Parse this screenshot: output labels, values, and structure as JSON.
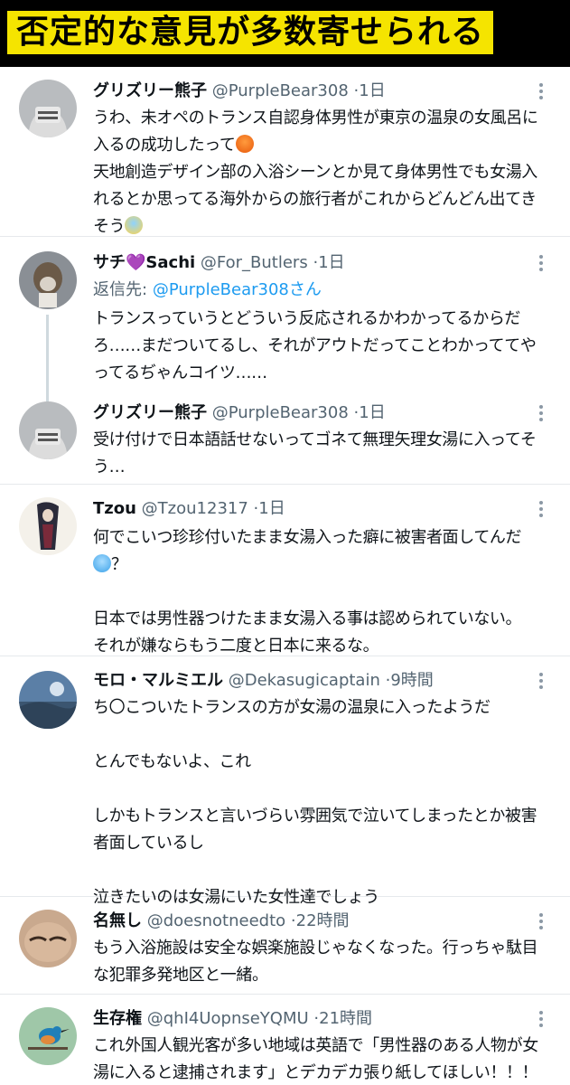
{
  "banner": {
    "title": "否定的な意見が多数寄せられる"
  },
  "tweets": [
    {
      "name": "グリズリー熊子",
      "handle": "@PurpleBear308",
      "sep": "·",
      "time": "1日",
      "lines": [
        "うわ、未オペのトランス自認身体男性が東京の温泉の女風呂に",
        "入るの成功したって",
        "天地創造デザイン部の入浴シーンとか見て身体男性でも女湯入",
        "れるとか思ってる海外からの旅行者がこれからどんどん出てき",
        "そう"
      ],
      "emoji": [
        "angry-face-icon",
        "screaming-face-icon"
      ]
    },
    {
      "name": "サチ",
      "name_suffix": "Sachi",
      "heart": "💜",
      "handle": "@For_Butlers",
      "sep": "·",
      "time": "1日",
      "reply_label": "返信先:",
      "reply_mention": "@PurpleBear308さん",
      "lines": [
        "トランスっていうとどういう反応されるかわかってるからだ",
        "ろ……まだついてるし、それがアウトだってことわかっててや",
        "ってるぢゃんコイツ……"
      ]
    },
    {
      "name": "グリズリー熊子",
      "handle": "@PurpleBear308",
      "sep": "·",
      "time": "1日",
      "lines": [
        "受け付けで日本語話せないってゴネて無理矢理女湯に入ってそ",
        "う…"
      ]
    },
    {
      "name": "Tzou",
      "handle": "@Tzou12317",
      "sep": "·",
      "time": "1日",
      "lines": [
        "何でこいつ珍珍付いたまま女湯入った癖に被害者面してんだ",
        "？",
        "",
        "日本では男性器つけたまま女湯入る事は認められていない。",
        "それが嫌ならもう二度と日本に来るな。"
      ],
      "emoji": [
        "cold-face-icon"
      ]
    },
    {
      "name": "モロ・マルミエル",
      "handle": "@Dekasugicaptain",
      "sep": "·",
      "time": "9時間",
      "lines": [
        "ち〇こついたトランスの方が女湯の温泉に入ったようだ",
        "",
        "とんでもないよ、これ",
        "",
        "しかもトランスと言いづらい雰囲気で泣いてしまったとか被害",
        "者面しているし",
        "",
        "泣きたいのは女湯にいた女性達でしょう"
      ]
    },
    {
      "name": "名無し",
      "handle": "@doesnotneedto",
      "sep": "·",
      "time": "22時間",
      "lines": [
        "もう入浴施設は安全な娯楽施設じゃなくなった。行っちゃ駄目",
        "な犯罪多発地区と一緒。"
      ]
    },
    {
      "name": "生存権",
      "handle": "@qhI4UopnseYQMU",
      "sep": "·",
      "time": "21時間",
      "lines": [
        "これ外国人観光客が多い地域は英語で「男性器のある人物が女",
        "湯に入ると逮捕されます」とデカデカ張り紙してほしい！！！"
      ]
    }
  ],
  "colors": {
    "banner_bg": "#000000",
    "banner_highlight": "#f5e400",
    "text": "#0f1419",
    "muted": "#536471",
    "link": "#1d9bf0",
    "divider": "#e6e9ec"
  }
}
